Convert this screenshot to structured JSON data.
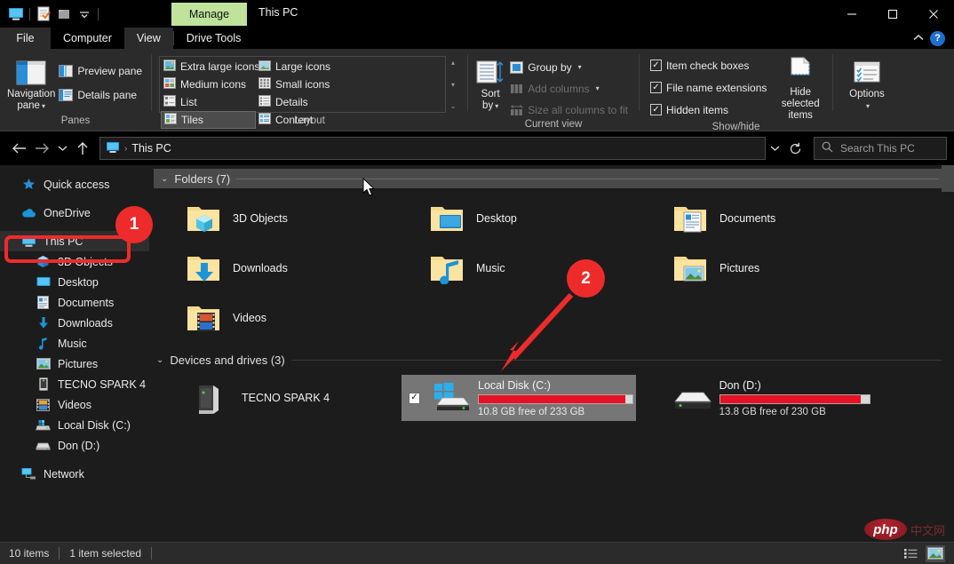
{
  "window": {
    "title": "This PC",
    "contextual_tab": "Manage",
    "quick_access_icons": [
      "this-pc-icon",
      "properties-icon",
      "new-folder-icon",
      "customize-dropdown-icon"
    ],
    "controls": {
      "minimize": "—",
      "maximize": "□",
      "close": "✕",
      "collapse_ribbon": "⌃",
      "help": "?"
    }
  },
  "tabs": [
    {
      "label": "File",
      "name": "tab-file",
      "active": false
    },
    {
      "label": "Computer",
      "name": "tab-computer",
      "active": false
    },
    {
      "label": "View",
      "name": "tab-view",
      "active": true
    },
    {
      "label": "Drive Tools",
      "name": "tab-drive-tools",
      "active": false
    }
  ],
  "ribbon": {
    "panes": {
      "label": "Panes",
      "navigation_pane": "Navigation\npane",
      "navigation_pane_line1": "Navigation",
      "navigation_pane_line2": "pane",
      "preview_pane": "Preview pane",
      "details_pane": "Details pane"
    },
    "layout": {
      "label": "Layout",
      "items": [
        {
          "label": "Extra large icons",
          "selected": false
        },
        {
          "label": "Large icons",
          "selected": false
        },
        {
          "label": "Medium icons",
          "selected": false
        },
        {
          "label": "Small icons",
          "selected": false
        },
        {
          "label": "List",
          "selected": false
        },
        {
          "label": "Details",
          "selected": false
        },
        {
          "label": "Tiles",
          "selected": true
        },
        {
          "label": "Content",
          "selected": false
        }
      ]
    },
    "current_view": {
      "label": "Current view",
      "sort_by_line1": "Sort",
      "sort_by_line2": "by",
      "group_by": "Group by",
      "add_columns": "Add columns",
      "size_all_columns": "Size all columns to fit"
    },
    "show_hide": {
      "label": "Show/hide",
      "item_check_boxes": {
        "label": "Item check boxes",
        "checked": true
      },
      "file_name_extensions": {
        "label": "File name extensions",
        "checked": true
      },
      "hidden_items": {
        "label": "Hidden items",
        "checked": true
      },
      "hide_selected_line1": "Hide selected",
      "hide_selected_line2": "items"
    },
    "options": {
      "label": "Options"
    }
  },
  "address_bar": {
    "back": "←",
    "forward": "→",
    "recent": "⌄",
    "up": "↑",
    "crumb_icon": "this-pc-icon",
    "crumb": "This PC",
    "crumb_sep": "›",
    "dropdown": "⌄",
    "refresh": "↻",
    "search_placeholder": "Search This PC"
  },
  "sidebar": {
    "items": [
      {
        "label": "Quick access",
        "icon": "star-icon",
        "level": "root",
        "selected": false
      },
      {
        "label": "OneDrive",
        "icon": "cloud-icon",
        "level": "root",
        "selected": false
      },
      {
        "label": "This PC",
        "icon": "this-pc-icon",
        "level": "root",
        "selected": true
      },
      {
        "label": "3D Objects",
        "icon": "3d-objects-icon",
        "level": "child",
        "selected": false
      },
      {
        "label": "Desktop",
        "icon": "desktop-icon",
        "level": "child",
        "selected": false
      },
      {
        "label": "Documents",
        "icon": "documents-icon",
        "level": "child",
        "selected": false
      },
      {
        "label": "Downloads",
        "icon": "downloads-icon",
        "level": "child",
        "selected": false
      },
      {
        "label": "Music",
        "icon": "music-icon",
        "level": "child",
        "selected": false
      },
      {
        "label": "Pictures",
        "icon": "pictures-icon",
        "level": "child",
        "selected": false
      },
      {
        "label": "TECNO SPARK 4",
        "icon": "phone-icon",
        "level": "child",
        "selected": false
      },
      {
        "label": "Videos",
        "icon": "videos-icon",
        "level": "child",
        "selected": false
      },
      {
        "label": "Local Disk (C:)",
        "icon": "local-disk-icon",
        "level": "child",
        "selected": false
      },
      {
        "label": "Don (D:)",
        "icon": "drive-icon",
        "level": "child",
        "selected": false
      },
      {
        "label": "Network",
        "icon": "network-icon",
        "level": "root",
        "selected": false
      }
    ]
  },
  "content": {
    "folders_group": {
      "title": "Folders (7)",
      "expanded": true
    },
    "folders": [
      {
        "label": "3D Objects",
        "icon": "folder-3d-objects-icon"
      },
      {
        "label": "Desktop",
        "icon": "folder-desktop-icon"
      },
      {
        "label": "Documents",
        "icon": "folder-documents-icon"
      },
      {
        "label": "Downloads",
        "icon": "folder-downloads-icon"
      },
      {
        "label": "Music",
        "icon": "folder-music-icon"
      },
      {
        "label": "Pictures",
        "icon": "folder-pictures-icon"
      },
      {
        "label": "Videos",
        "icon": "folder-videos-icon"
      }
    ],
    "devices_group": {
      "title": "Devices and drives (3)",
      "expanded": true
    },
    "devices": [
      {
        "name": "TECNO SPARK 4",
        "icon": "phone-device-icon",
        "has_bar": false,
        "selected": false,
        "checked": false
      },
      {
        "name": "Local Disk (C:)",
        "icon": "windows-drive-icon",
        "has_bar": true,
        "free_text": "10.8 GB free of 233 GB",
        "used_percent": 95.4,
        "selected": true,
        "checked": true
      },
      {
        "name": "Don (D:)",
        "icon": "hard-drive-icon",
        "has_bar": true,
        "free_text": "13.8 GB free of 230 GB",
        "used_percent": 94.0,
        "selected": false,
        "checked": false
      }
    ]
  },
  "status_bar": {
    "item_count": "10 items",
    "selection": "1 item selected",
    "view_details_icon": "details-view-icon",
    "view_large_icons_icon": "large-icons-view-icon"
  },
  "annotations": {
    "badge_one": "1",
    "badge_two": "2"
  },
  "watermark": {
    "php": "php",
    "cn": "中文网"
  },
  "colors": {
    "accent_red": "#ee2b2b",
    "manage_tab_green": "#bfe39b",
    "drive_bar_red": "#e81123",
    "selection_gray": "#767676",
    "ribbon_bg": "#2b2b2b",
    "pane_bg": "#1c1c1c"
  }
}
